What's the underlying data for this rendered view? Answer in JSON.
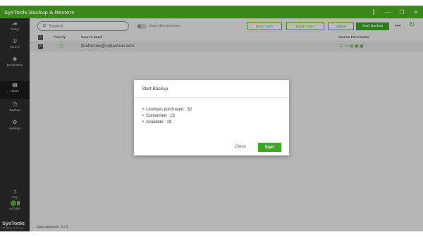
{
  "app": {
    "title": "SysTools Backup & Restore"
  },
  "window_controls": {
    "kebab": "⋮",
    "minimize": "—",
    "restore": "❐",
    "close": "✕"
  },
  "sidebar": {
    "items": [
      {
        "label": "Setup",
        "icon": "cloud-icon",
        "glyph": "☁"
      },
      {
        "label": "Source",
        "icon": "settings-icon",
        "glyph": "◎"
      },
      {
        "label": "Destination",
        "icon": "destination-icon",
        "glyph": "◆"
      },
      {
        "label": "Users",
        "icon": "users-icon",
        "glyph": "▤",
        "active": true
      },
      {
        "label": "Backup",
        "icon": "backup-icon",
        "glyph": "◷"
      },
      {
        "label": "Settings",
        "icon": "gear-icon",
        "glyph": "✿"
      }
    ],
    "help": {
      "label": "Help",
      "glyph": "?"
    },
    "activate": {
      "label": "Activate"
    },
    "brand": {
      "name": "SysTools",
      "tagline": "Simplifying Technology"
    }
  },
  "toolbar": {
    "search_placeholder": "Search",
    "toggle_label": "Show selected users",
    "fetch_users": "Fetch Users",
    "import_users": "Import Users",
    "validate": "Validate",
    "start_backup": "Start Backup",
    "more": "•••",
    "refresh_glyph": "↻"
  },
  "table": {
    "headers": {
      "priority": "Priority",
      "source_email": "Source Email",
      "source_permission": "Source Permission"
    },
    "rows": [
      {
        "email": "finalsmoke@sobarcsas.com",
        "checked": true,
        "starred": true
      }
    ],
    "permission_glyphs": [
      "⇩",
      "▭",
      "▤",
      "▣",
      "▦"
    ]
  },
  "status": {
    "users_selected": "User selected : 1 / 1"
  },
  "modal": {
    "title": "Start Backup",
    "lines": [
      "Licenses purchased : 32",
      "Consumed : 13",
      "Available : 19"
    ],
    "close_label": "Close",
    "start_label": "Start"
  },
  "colors": {
    "brand_green": "#4caf1f",
    "sidebar_bg": "#2d2d2d"
  }
}
